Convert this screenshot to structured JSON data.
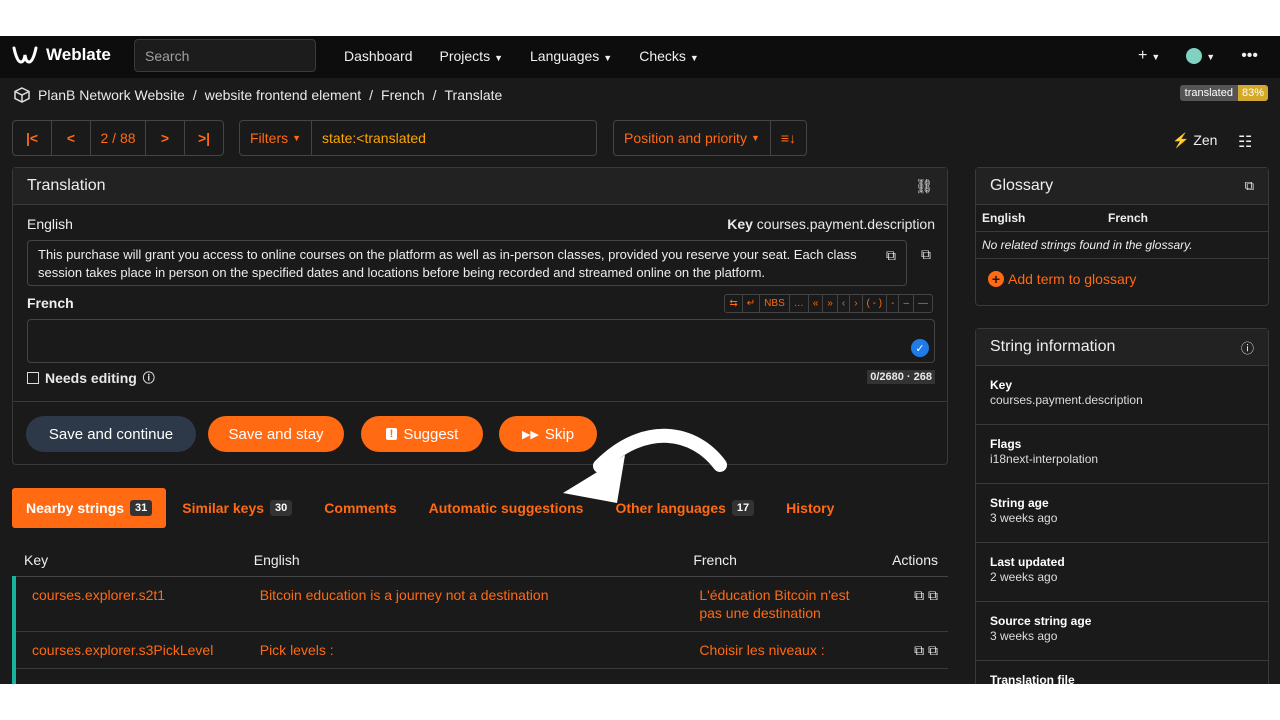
{
  "nav": {
    "brand": "Weblate",
    "search_placeholder": "Search",
    "links": [
      "Dashboard",
      "Projects",
      "Languages",
      "Checks"
    ],
    "plus": "+",
    "more": "•••"
  },
  "breadcrumb": {
    "items": [
      "PlanB Network Website",
      "website frontend element",
      "French",
      "Translate"
    ],
    "separator": "/"
  },
  "status_badge": {
    "label": "translated",
    "percent": "83%"
  },
  "pager": {
    "first": "|<",
    "prev": "<",
    "position": "2 / 88",
    "next": ">",
    "last": ">|"
  },
  "filters": {
    "button": "Filters",
    "query": "state:<translated"
  },
  "sort": {
    "label": "Position and priority",
    "dir_icon": "≡↓"
  },
  "zen": "Zen",
  "translation": {
    "title": "Translation",
    "source_lang": "English",
    "key_label": "Key",
    "key_value": "courses.payment.description",
    "source_text": "This purchase will grant you access to online courses on the platform as well as in-person classes, provided you reserve your seat. Each class session takes place in person on the specified dates and locations before being recorded and streamed online on the platform.",
    "target_lang": "French",
    "tools": [
      "⇆",
      "↵",
      "NBS",
      "…",
      "«",
      "»",
      "‹",
      "›",
      "( - )",
      "-",
      "–",
      "—"
    ],
    "needs_editing": "Needs editing",
    "counter": "0/2680 · 268"
  },
  "buttons": {
    "save_continue": "Save and continue",
    "save_stay": "Save and stay",
    "suggest": "Suggest",
    "skip": "Skip"
  },
  "tabs": [
    {
      "label": "Nearby strings",
      "count": "31"
    },
    {
      "label": "Similar keys",
      "count": "30"
    },
    {
      "label": "Comments",
      "count": ""
    },
    {
      "label": "Automatic suggestions",
      "count": ""
    },
    {
      "label": "Other languages",
      "count": "17"
    },
    {
      "label": "History",
      "count": ""
    }
  ],
  "table": {
    "headers": [
      "Key",
      "English",
      "French",
      "Actions"
    ],
    "rows": [
      {
        "key": "courses.explorer.s2t1",
        "english": "Bitcoin education is a journey not a destination",
        "french": "L'éducation Bitcoin n'est pas une destination"
      },
      {
        "key": "courses.explorer.s3PickLevel",
        "english": "Pick levels :",
        "french": "Choisir les niveaux :"
      }
    ]
  },
  "glossary": {
    "title": "Glossary",
    "col_source": "English",
    "col_target": "French",
    "empty": "No related strings found in the glossary.",
    "add": "Add term to glossary"
  },
  "string_info": {
    "title": "String information",
    "items": [
      {
        "label": "Key",
        "value": "courses.payment.description"
      },
      {
        "label": "Flags",
        "value": "i18next-interpolation"
      },
      {
        "label": "String age",
        "value": "3 weeks ago"
      },
      {
        "label": "Last updated",
        "value": "2 weeks ago"
      },
      {
        "label": "Source string age",
        "value": "3 weeks ago"
      },
      {
        "label": "Translation file",
        "value": ""
      }
    ]
  },
  "colors": {
    "accent": "#ff6a13",
    "bg": "#1a1a1a",
    "teal": "#19b39b",
    "badge": "#d4a82a"
  }
}
